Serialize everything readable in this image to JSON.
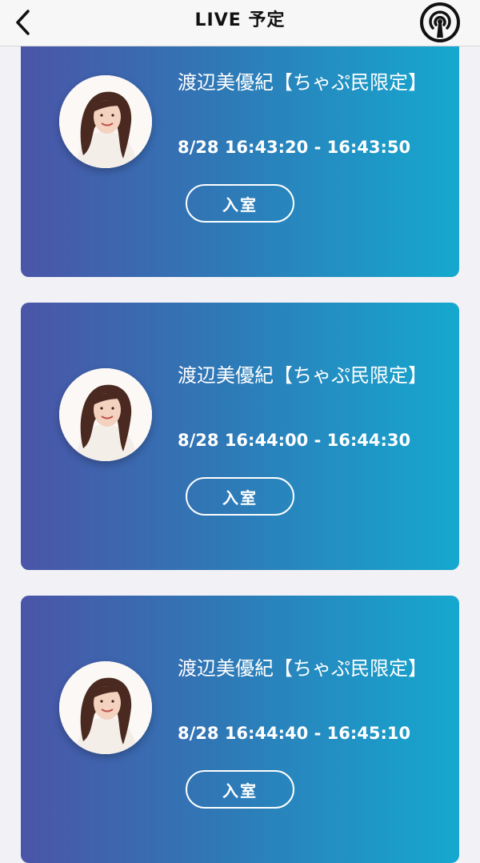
{
  "header": {
    "title": "LIVE 予定",
    "back_icon": "chevron-left-icon",
    "broadcast_icon": "broadcast-icon"
  },
  "colors": {
    "card_gradient_start": "#4b55a8",
    "card_gradient_end": "#15a8cf",
    "background": "#f2f1f6"
  },
  "events": [
    {
      "title": "渡辺美優紀【ちゃぷ民限定】",
      "time": "8/28 16:43:20 - 16:43:50",
      "button": "入室"
    },
    {
      "title": "渡辺美優紀【ちゃぷ民限定】",
      "time": "8/28 16:44:00 - 16:44:30",
      "button": "入室"
    },
    {
      "title": "渡辺美優紀【ちゃぷ民限定】",
      "time": "8/28 16:44:40 - 16:45:10",
      "button": "入室"
    }
  ]
}
